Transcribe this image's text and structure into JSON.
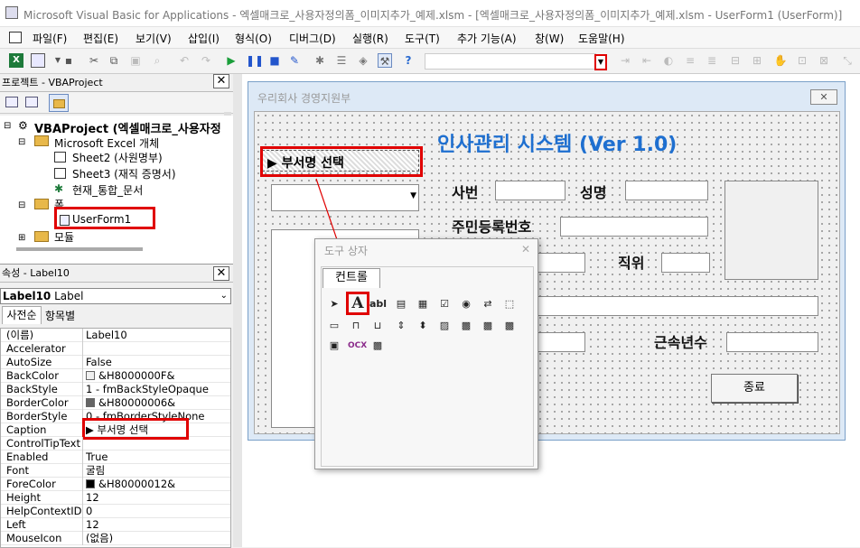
{
  "window": {
    "title": "Microsoft Visual Basic for Applications - 엑셀매크로_사용자정의폼_이미지추가_예제.xlsm - [엑셀매크로_사용자정의폼_이미지추가_예제.xlsm - UserForm1 (UserForm)]"
  },
  "menu": [
    "파일(F)",
    "편집(E)",
    "보기(V)",
    "삽입(I)",
    "형식(O)",
    "디버그(D)",
    "실행(R)",
    "도구(T)",
    "추가 기능(A)",
    "창(W)",
    "도움말(H)"
  ],
  "project": {
    "title": "프로젝트 - VBAProject",
    "root": "VBAProject (엑셀매크로_사용자정",
    "excel_objects": "Microsoft Excel 개체",
    "sheet2": "Sheet2 (사원명부)",
    "sheet3": "Sheet3 (재직 증명서)",
    "thisworkbook": "현재_통합_문서",
    "forms": "폼",
    "userform": "UserForm1",
    "modules": "모듈"
  },
  "properties": {
    "title": "속성 - Label10",
    "object": "Label10",
    "object_type": "Label",
    "tab_alpha": "사전순",
    "tab_cat": "항목별",
    "rows": [
      {
        "k": "(이름)",
        "v": "Label10"
      },
      {
        "k": "Accelerator",
        "v": ""
      },
      {
        "k": "AutoSize",
        "v": "False"
      },
      {
        "k": "BackColor",
        "v": "&H8000000F&"
      },
      {
        "k": "BackStyle",
        "v": "1 - fmBackStyleOpaque"
      },
      {
        "k": "BorderColor",
        "v": "&H80000006&"
      },
      {
        "k": "BorderStyle",
        "v": "0 - fmBorderStyleNone"
      },
      {
        "k": "Caption",
        "v": "▶ 부서명 선택"
      },
      {
        "k": "ControlTipText",
        "v": ""
      },
      {
        "k": "Enabled",
        "v": "True"
      },
      {
        "k": "Font",
        "v": "굴림"
      },
      {
        "k": "ForeColor",
        "v": "&H80000012&"
      },
      {
        "k": "Height",
        "v": "12"
      },
      {
        "k": "HelpContextID",
        "v": "0"
      },
      {
        "k": "Left",
        "v": "12"
      },
      {
        "k": "MouseIcon",
        "v": "(없음)"
      }
    ]
  },
  "form": {
    "caption": "우리회사 경영지원부",
    "close": "✕",
    "heading": "인사관리 시스템 (Ver 1.0)",
    "dept_label": "▶ 부서명 선택",
    "emp_no": "사번",
    "name": "성명",
    "rrn": "주민등록번호",
    "position": "직위",
    "years": "근속년수",
    "close_button": "종료"
  },
  "toolbox": {
    "title": "도구 상자",
    "close": "✕",
    "tab": "컨트롤",
    "label_tool": "A",
    "textbox_tool": "abl",
    "ocx": "OCX"
  },
  "colors": {
    "accent": "#1e6fd0",
    "highlight": "#e00000"
  }
}
